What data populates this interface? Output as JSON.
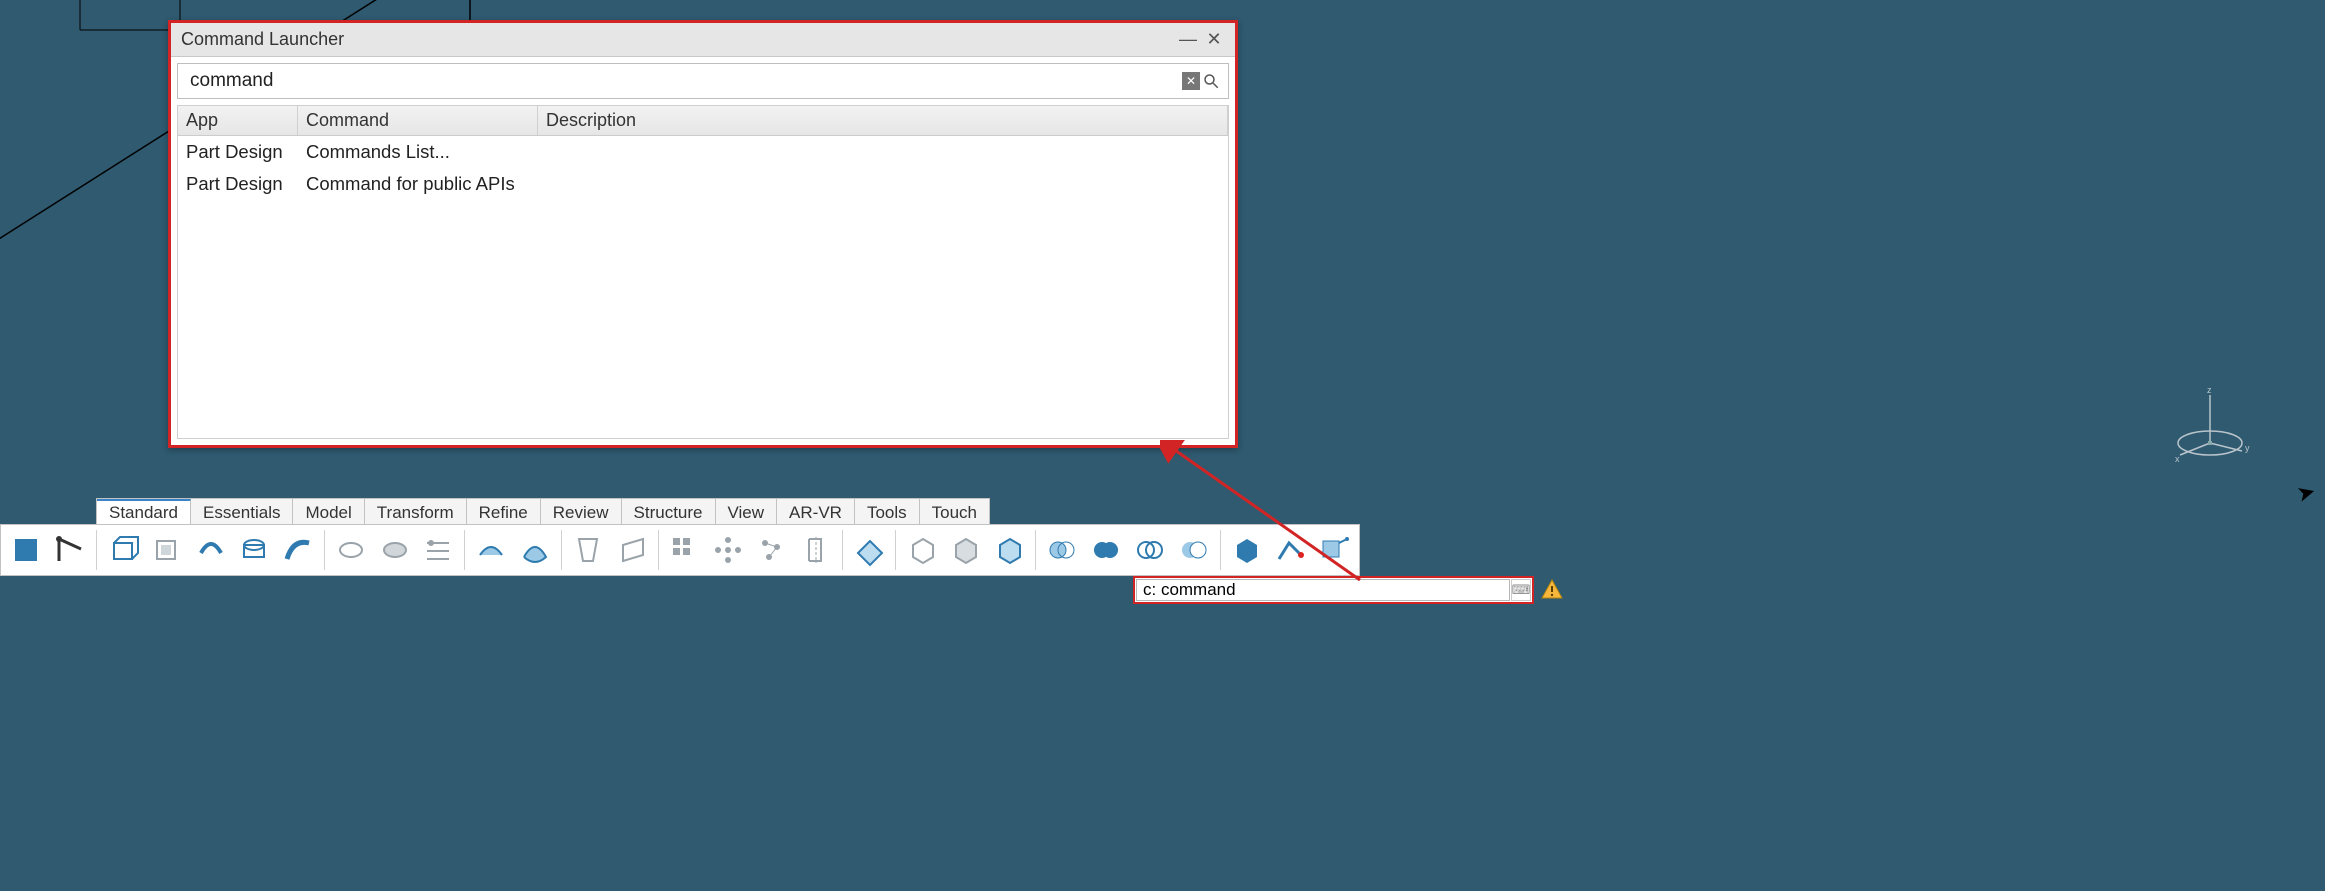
{
  "dialog": {
    "title": "Command Launcher",
    "search_value": "command",
    "columns": {
      "app": "App",
      "command": "Command",
      "description": "Description"
    },
    "results": [
      {
        "app": "Part Design",
        "command": "Commands List...",
        "description": ""
      },
      {
        "app": "Part Design",
        "command": "Command for public APIs",
        "description": ""
      }
    ]
  },
  "tabs": [
    {
      "label": "Standard",
      "active": true
    },
    {
      "label": "Essentials"
    },
    {
      "label": "Model"
    },
    {
      "label": "Transform"
    },
    {
      "label": "Refine"
    },
    {
      "label": "Review"
    },
    {
      "label": "Structure"
    },
    {
      "label": "View"
    },
    {
      "label": "AR-VR"
    },
    {
      "label": "Tools"
    },
    {
      "label": "Touch"
    }
  ],
  "command_input": {
    "value": "c: command"
  },
  "toolbar_icons": [
    "sketch-icon",
    "axis-icon",
    "pad-icon",
    "pocket-icon",
    "revolve-icon",
    "groove-icon",
    "sweep-icon",
    "rib-icon",
    "slot-icon",
    "multi-sections-icon",
    "surface-1-icon",
    "surface-2-icon",
    "draft-icon",
    "thickness-icon",
    "pattern-rect-icon",
    "pattern-circ-icon",
    "pattern-user-icon",
    "mirror-icon",
    "plane-icon",
    "box-1-icon",
    "box-2-icon",
    "box-3-icon",
    "boolean-1-icon",
    "boolean-2-icon",
    "boolean-3-icon",
    "boolean-4-icon",
    "solid-icon",
    "wire-icon",
    "annotation-icon"
  ]
}
